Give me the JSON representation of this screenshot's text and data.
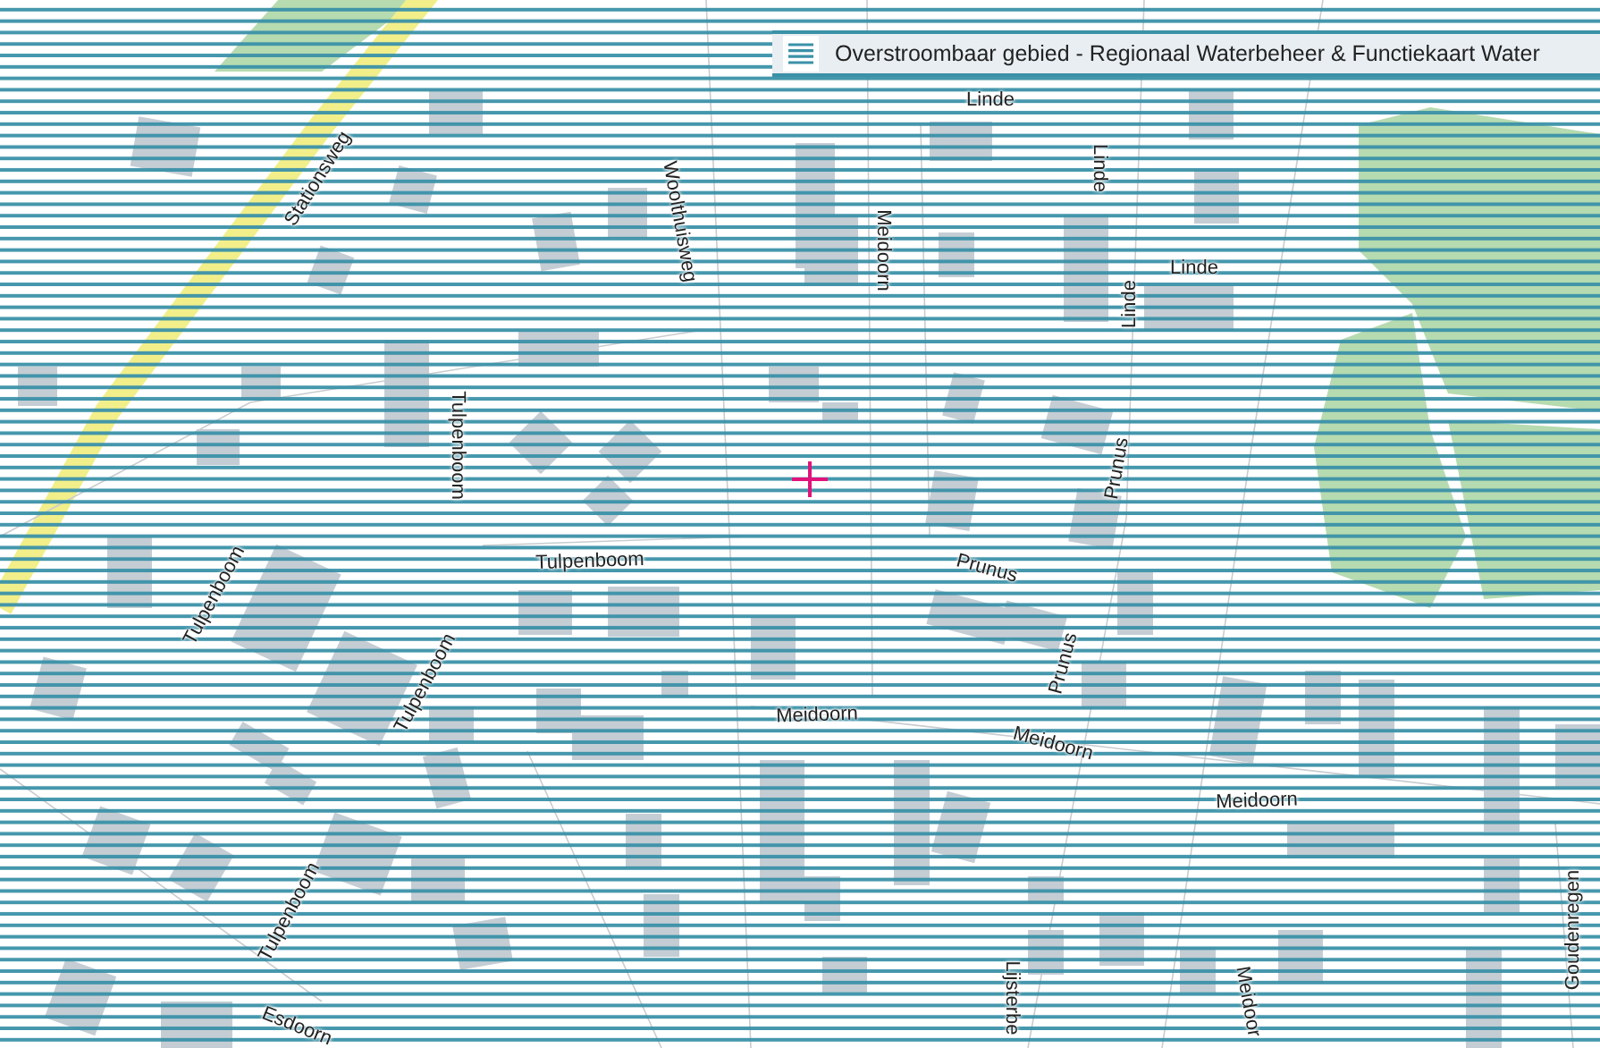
{
  "layer_bar": {
    "title": "Overstroombaar gebied - Regionaal Waterbeheer & Functiekaart Water"
  },
  "map": {
    "street_labels": [
      {
        "text": "Stationsweg"
      },
      {
        "text": "Woolthuisweg"
      },
      {
        "text": "Meidoorn"
      },
      {
        "text": "Linde"
      },
      {
        "text": "Linde"
      },
      {
        "text": "Linde"
      },
      {
        "text": "Linde"
      },
      {
        "text": "Tulpenboom"
      },
      {
        "text": "Tulpenboom"
      },
      {
        "text": "Tulpenboom"
      },
      {
        "text": "Tulpenboom"
      },
      {
        "text": "Tulpenboom"
      },
      {
        "text": "Prunus"
      },
      {
        "text": "Prunus"
      },
      {
        "text": "Prunus"
      },
      {
        "text": "Meidoorn"
      },
      {
        "text": "Meidoorn"
      },
      {
        "text": "Meidoorn"
      },
      {
        "text": "Esdoorn"
      },
      {
        "text": "Lijsterbe"
      },
      {
        "text": "Meidoor"
      },
      {
        "text": "Goudenregen"
      }
    ]
  }
}
